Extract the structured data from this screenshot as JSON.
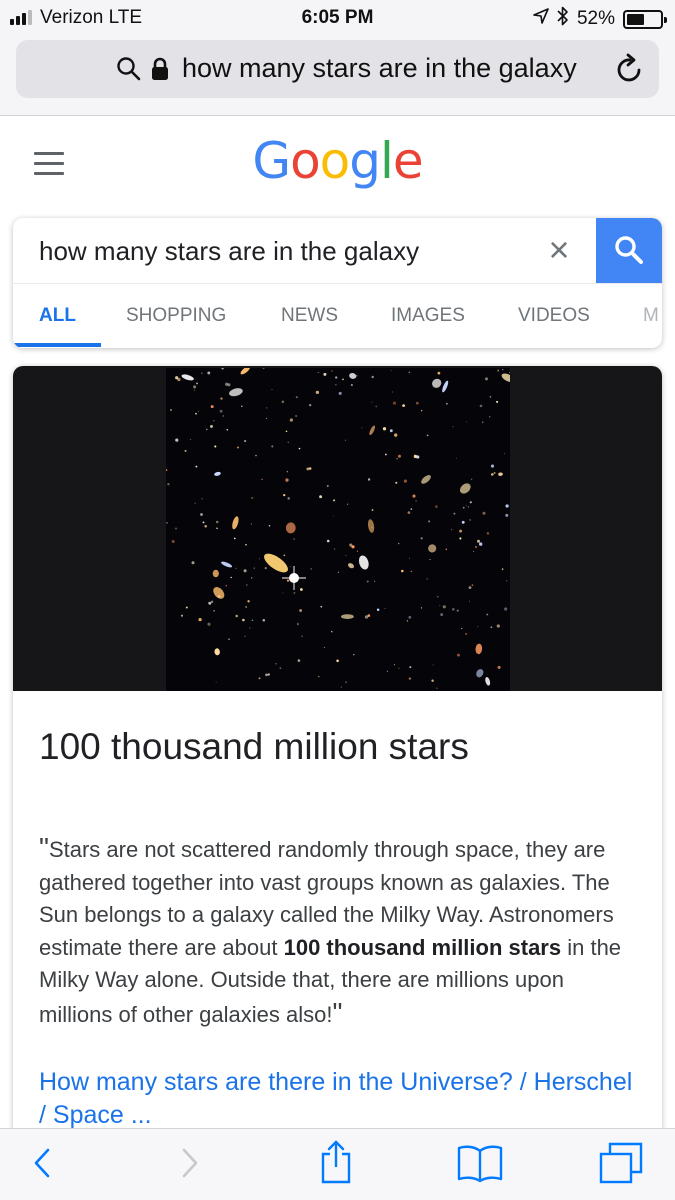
{
  "status_bar": {
    "carrier": "Verizon  LTE",
    "time": "6:05 PM",
    "battery_percent": "52%",
    "battery_level": 0.52,
    "icons": [
      "signal-icon",
      "location-arrow-icon",
      "bluetooth-icon",
      "battery-icon"
    ]
  },
  "browser": {
    "address_text": "how many stars are in the galaxy",
    "icons": [
      "search-icon",
      "lock-icon",
      "reload-icon"
    ]
  },
  "google": {
    "logo_letters": [
      {
        "char": "G",
        "color": "#4285F4"
      },
      {
        "char": "o",
        "color": "#EA4335"
      },
      {
        "char": "o",
        "color": "#FBBC05"
      },
      {
        "char": "g",
        "color": "#4285F4"
      },
      {
        "char": "l",
        "color": "#34A853"
      },
      {
        "char": "e",
        "color": "#EA4335"
      }
    ],
    "query": "how many stars are in the galaxy",
    "clear_symbol": "×",
    "tabs": [
      {
        "label": "ALL",
        "active": true
      },
      {
        "label": "SHOPPING",
        "active": false
      },
      {
        "label": "NEWS",
        "active": false
      },
      {
        "label": "IMAGES",
        "active": false
      },
      {
        "label": "VIDEOS",
        "active": false
      },
      {
        "label": "M",
        "active": false
      }
    ],
    "accent_color": "#4285f4"
  },
  "result": {
    "image_alt": "Hubble deep field image",
    "title": "100 thousand million stars",
    "open_quote": "\"",
    "snippet_before": "Stars are not scattered randomly through space, they are gathered together into vast groups known as galaxies. The Sun belongs to a galaxy called the Milky Way. Astronomers estimate there are about ",
    "snippet_bold": "100 thousand million stars",
    "snippet_after": " in the Milky Way alone. Outside that, there are millions upon millions of other galaxies also!",
    "close_quote": "\"",
    "link_text": "How many stars are there in the Universe? / Herschel / Space ..."
  },
  "toolbar": {
    "icons": [
      "back-icon",
      "forward-icon",
      "share-icon",
      "bookmarks-icon",
      "tabs-icon"
    ],
    "accent_color": "#007aff"
  }
}
